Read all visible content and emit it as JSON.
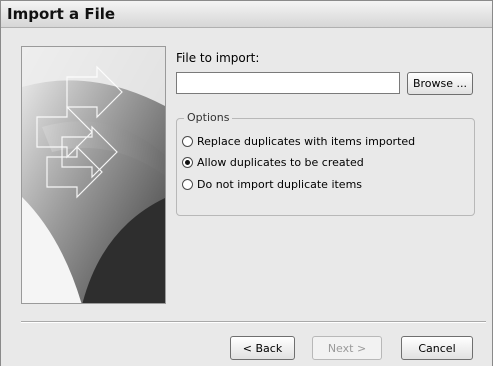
{
  "window": {
    "title": "Import a File"
  },
  "file": {
    "label": "File to import:",
    "value": "",
    "browse_label": "Browse ..."
  },
  "options": {
    "legend": "Options",
    "items": [
      {
        "label": "Replace duplicates with items imported",
        "selected": false
      },
      {
        "label": "Allow duplicates to be created",
        "selected": true
      },
      {
        "label": "Do not import duplicate items",
        "selected": false
      }
    ]
  },
  "footer": {
    "back_label": "< Back",
    "next_label": "Next >",
    "cancel_label": "Cancel"
  }
}
